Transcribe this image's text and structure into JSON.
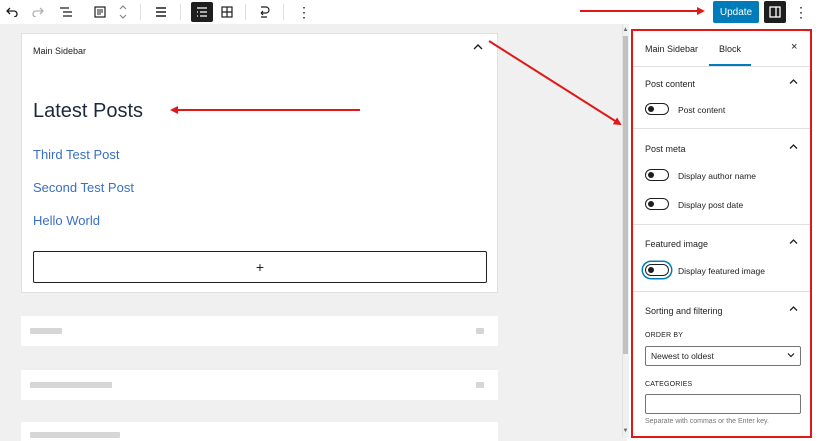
{
  "toolbar": {
    "update_label": "Update",
    "more_label": "⋮"
  },
  "widget": {
    "title": "Main Sidebar",
    "heading": "Latest Posts",
    "posts": [
      "Third Test Post",
      "Second Test Post",
      "Hello World"
    ],
    "add_label": "+"
  },
  "sidebar": {
    "tabs": [
      "Main Sidebar",
      "Block"
    ],
    "active_tab": "Block",
    "close_label": "×",
    "sections": {
      "post_content": {
        "title": "Post content",
        "toggle_label": "Post content"
      },
      "post_meta": {
        "title": "Post meta",
        "toggles": [
          "Display author name",
          "Display post date"
        ]
      },
      "featured_image": {
        "title": "Featured image",
        "toggle_label": "Display featured image"
      },
      "sorting": {
        "title": "Sorting and filtering",
        "order_by_label": "ORDER BY",
        "order_by_value": "Newest to oldest",
        "categories_label": "CATEGORIES",
        "categories_help": "Separate with commas or the Enter key."
      }
    }
  },
  "colors": {
    "accent": "#007cba",
    "annotation": "#e01818",
    "link": "#3a6fc4"
  },
  "icons": [
    "undo-icon",
    "redo-icon",
    "list-view-icon",
    "document-outline-icon",
    "move-arrows-icon",
    "align-icon",
    "list-layout-icon",
    "grid-layout-icon",
    "transform-icon",
    "more-options-icon",
    "settings-panel-icon",
    "chevron-up-icon",
    "close-icon",
    "chevron-down-icon"
  ]
}
